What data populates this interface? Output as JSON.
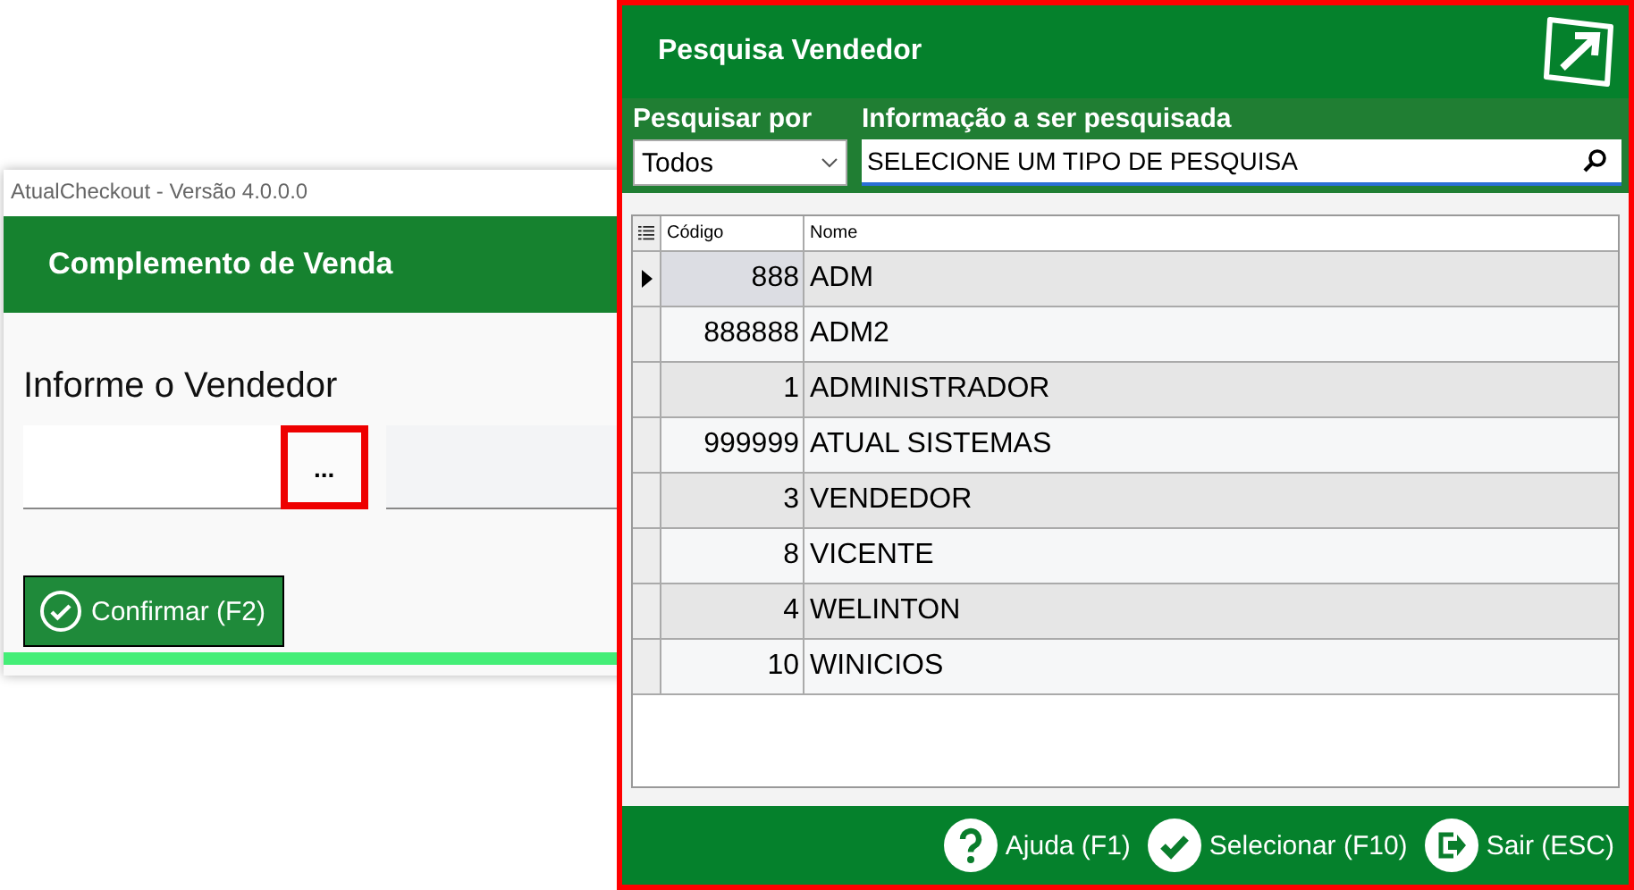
{
  "back_window": {
    "title": "AtualCheckout - Versão 4.0.0.0",
    "header": "Complemento de Venda",
    "label": "Informe o Vendedor",
    "browse_button": {
      "label": "...",
      "highlighted": true
    },
    "confirm_button": "Confirmar (F2)"
  },
  "dialog": {
    "title": "Pesquisa Vendedor",
    "highlighted": true,
    "search_by": {
      "label": "Pesquisar por",
      "value": "Todos"
    },
    "search_info": {
      "label": "Informação a ser pesquisada",
      "value": "SELECIONE UM TIPO DE PESQUISA"
    },
    "table": {
      "columns": [
        "Código",
        "Nome"
      ],
      "rows": [
        {
          "code": "888",
          "name": "ADM",
          "selected": true
        },
        {
          "code": "888888",
          "name": "ADM2",
          "selected": false
        },
        {
          "code": "1",
          "name": "ADMINISTRADOR",
          "selected": false
        },
        {
          "code": "999999",
          "name": "ATUAL SISTEMAS",
          "selected": false
        },
        {
          "code": "3",
          "name": "VENDEDOR",
          "selected": false
        },
        {
          "code": "8",
          "name": "VICENTE",
          "selected": false
        },
        {
          "code": "4",
          "name": "WELINTON",
          "selected": false
        },
        {
          "code": "10",
          "name": "WINICIOS",
          "selected": false
        }
      ]
    },
    "buttons": [
      {
        "kind": "help",
        "label": "Ajuda (F1)"
      },
      {
        "kind": "select",
        "label": "Selecionar (F10)"
      },
      {
        "kind": "exit",
        "label": "Sair (ESC)"
      }
    ]
  }
}
